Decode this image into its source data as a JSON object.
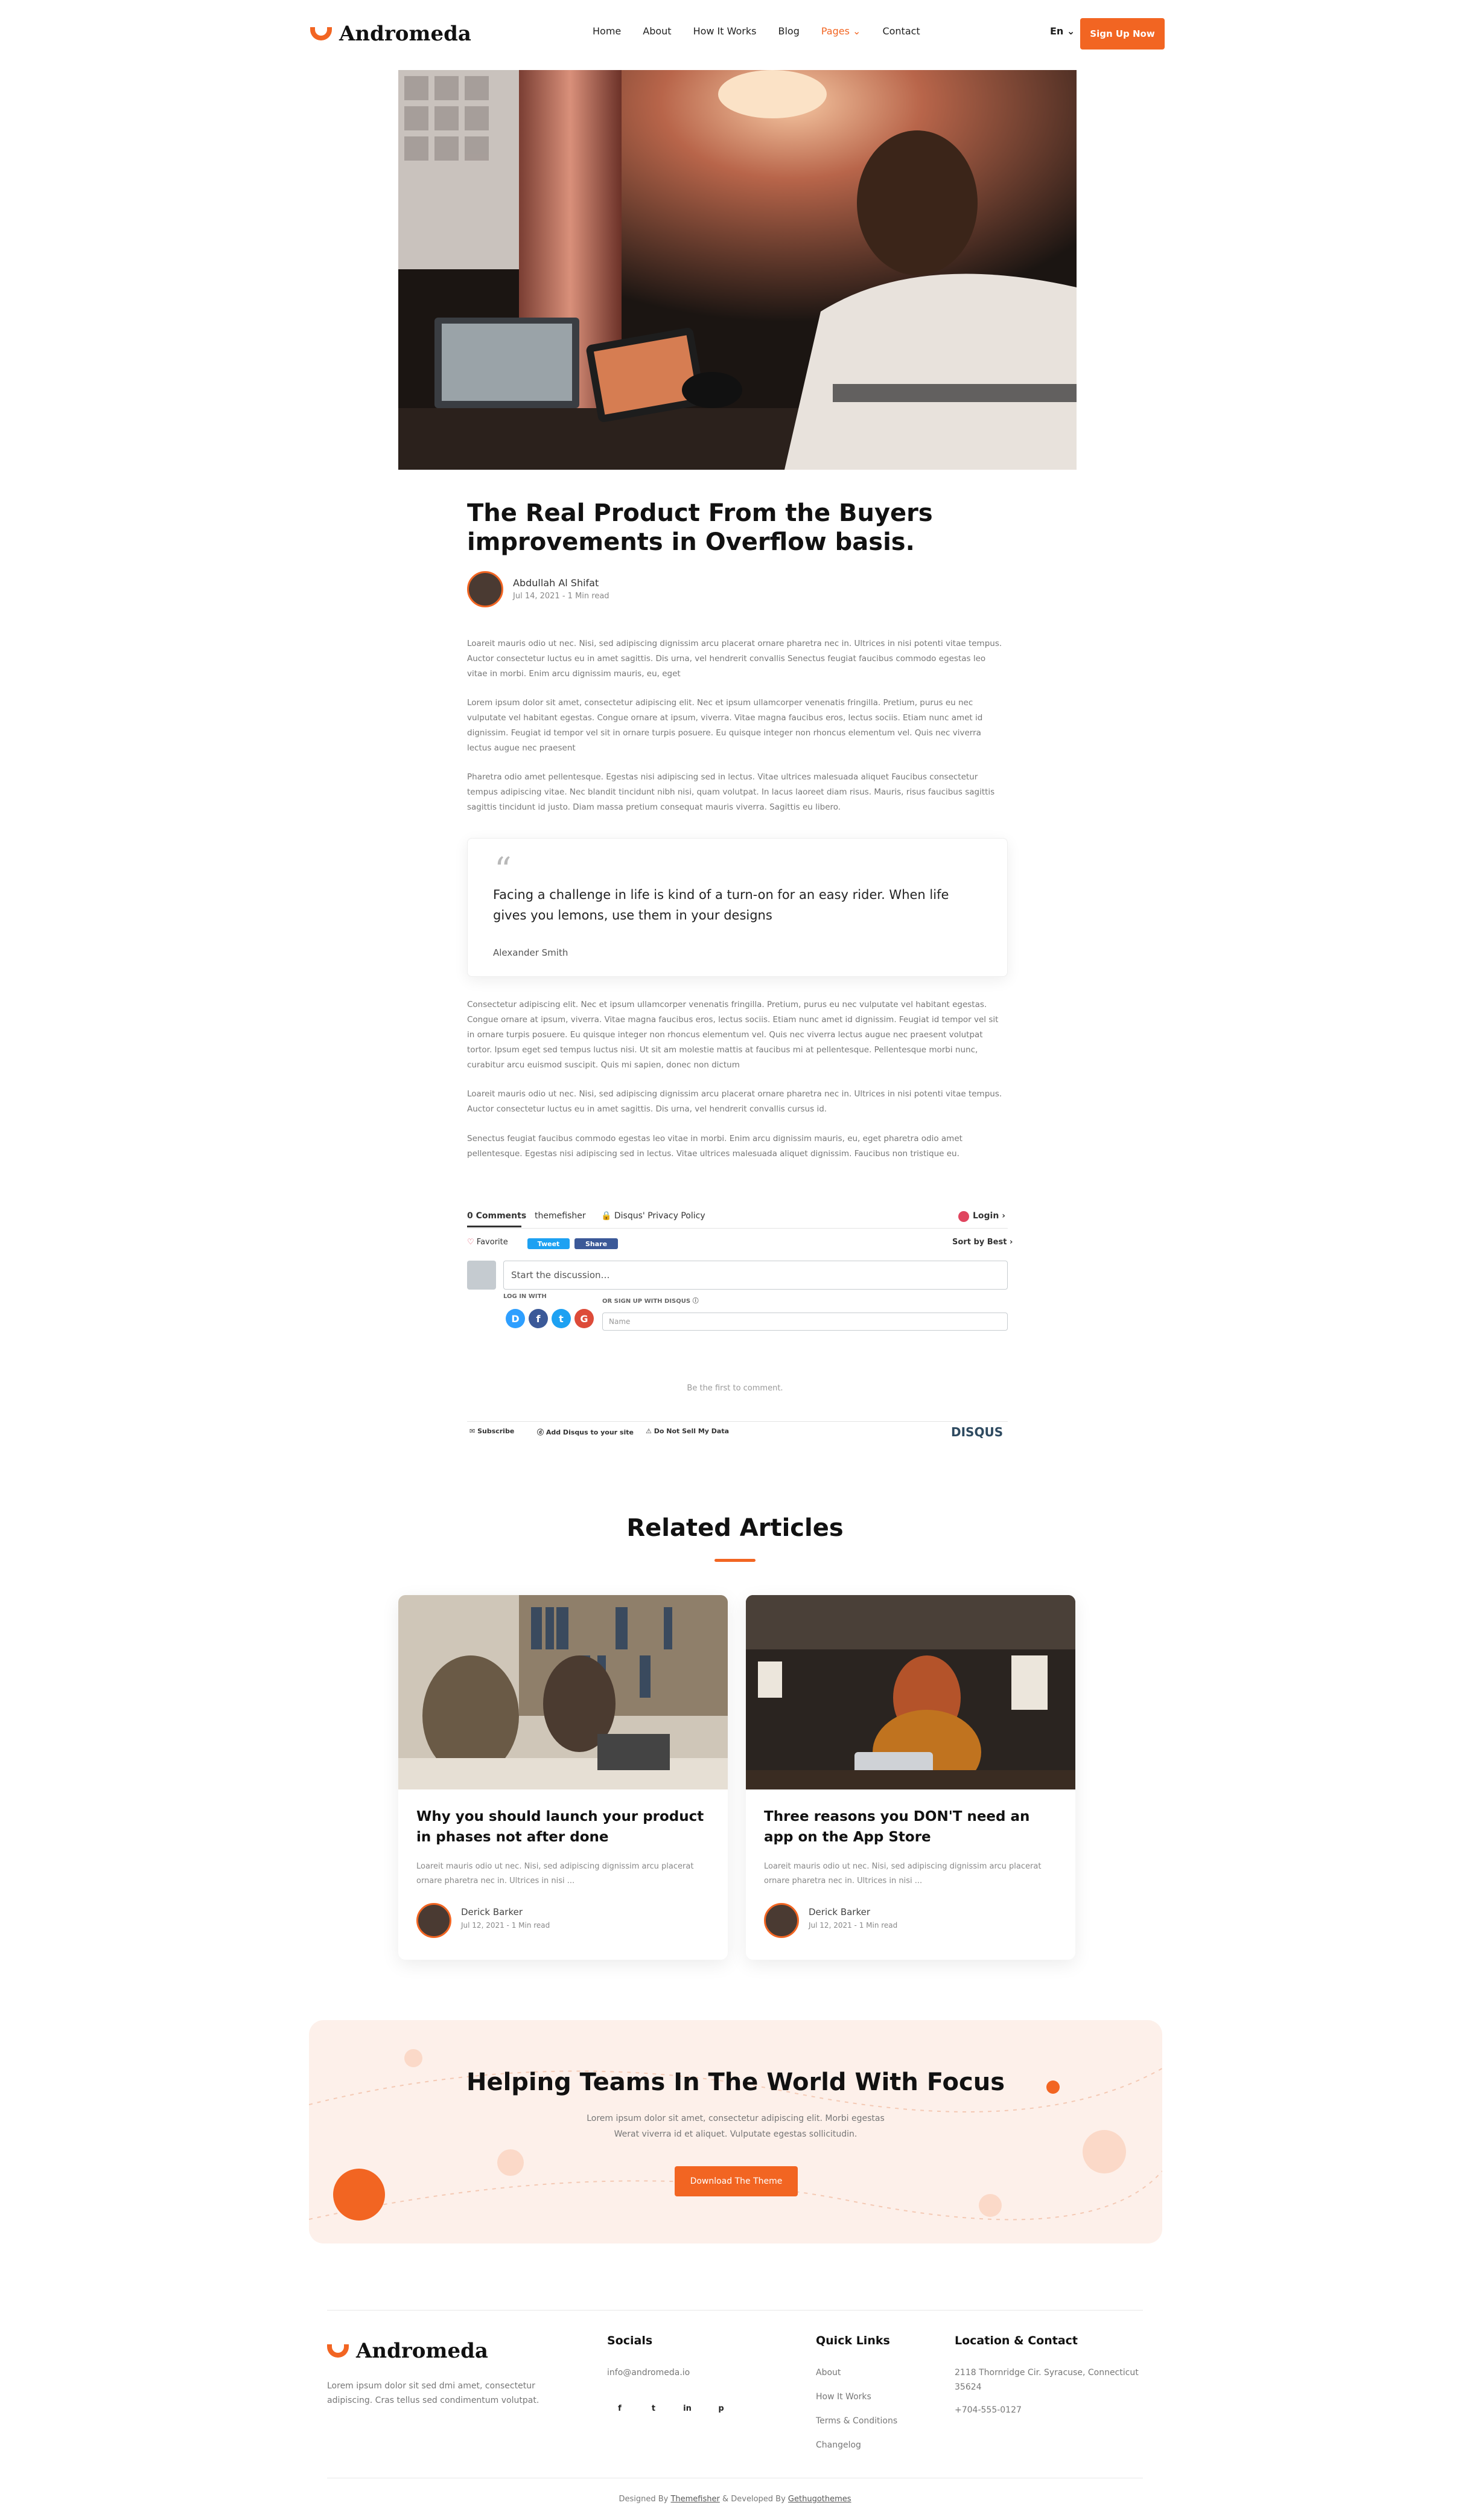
{
  "header": {
    "logo": "Andromeda",
    "nav": [
      "Home",
      "About",
      "How It Works",
      "Blog",
      "Pages",
      "Contact"
    ],
    "active_nav": "Pages",
    "language": "En",
    "signup_label": "Sign Up Now"
  },
  "article": {
    "title_line1": "The Real Product From the Buyers",
    "title_line2": "improvements in Overflow basis.",
    "author": "Abdullah Al Shifat",
    "meta": "Jul 14, 2021 - 1 Min read",
    "paragraphs": [
      "Loareit mauris odio ut nec. Nisi, sed adipiscing dignissim arcu placerat ornare pharetra nec in. Ultrices in nisi potenti vitae tempus. Auctor consectetur luctus eu in amet sagittis. Dis urna, vel hendrerit convallis Senectus feugiat faucibus commodo egestas leo vitae in morbi. Enim arcu dignissim mauris, eu, eget",
      "Lorem ipsum dolor sit amet, consectetur adipiscing elit. Nec et ipsum ullamcorper venenatis fringilla. Pretium, purus eu nec vulputate vel habitant egestas. Congue ornare at ipsum, viverra. Vitae magna faucibus eros, lectus sociis. Etiam nunc amet id dignissim. Feugiat id tempor vel sit in ornare turpis posuere. Eu quisque integer non rhoncus elementum vel. Quis nec viverra lectus augue nec praesent",
      "Pharetra odio amet pellentesque. Egestas nisi adipiscing sed in lectus. Vitae ultrices malesuada aliquet Faucibus consectetur tempus adipiscing vitae. Nec blandit tincidunt nibh nisi, quam volutpat. In lacus laoreet diam risus. Mauris, risus faucibus sagittis sagittis tincidunt id justo. Diam massa pretium consequat mauris viverra. Sagittis eu libero.",
      "Consectetur adipiscing elit. Nec et ipsum ullamcorper venenatis fringilla. Pretium, purus eu nec vulputate vel habitant egestas. Congue ornare at ipsum, viverra. Vitae magna faucibus eros, lectus sociis. Etiam nunc amet id dignissim. Feugiat id tempor vel sit in ornare turpis posuere. Eu quisque integer non rhoncus elementum vel. Quis nec viverra lectus augue nec praesent volutpat tortor. Ipsum eget sed tempus luctus nisi. Ut sit am molestie mattis at faucibus mi at pellentesque. Pellentesque morbi nunc, curabitur arcu euismod suscipit. Quis mi sapien, donec non dictum",
      "Loareit mauris odio ut nec. Nisi, sed adipiscing dignissim arcu placerat ornare pharetra nec in. Ultrices in nisi potenti vitae tempus. Auctor consectetur luctus eu in amet sagittis. Dis urna, vel hendrerit convallis cursus id.",
      "Senectus feugiat faucibus commodo egestas leo vitae in morbi. Enim arcu dignissim mauris, eu, eget pharetra odio amet pellentesque. Egestas nisi adipiscing sed in lectus. Vitae ultrices malesuada aliquet dignissim. Faucibus non tristique eu."
    ],
    "quote": "Facing a challenge in life is kind of a turn-on for an easy rider. When life gives you lemons, use them in your designs",
    "quote_author": "Alexander Smith"
  },
  "disqus": {
    "comments_tab": "0 Comments",
    "site": "themefisher",
    "privacy": "Disqus' Privacy Policy",
    "login": "Login",
    "favorite": "Favorite",
    "tweet": "Tweet",
    "share": "Share",
    "sort": "Sort by Best",
    "placeholder": "Start the discussion…",
    "log_in_with": "LOG IN WITH",
    "or_signup": "OR SIGN UP WITH DISQUS",
    "name_placeholder": "Name",
    "empty": "Be the first to comment.",
    "subscribe": "Subscribe",
    "add_disqus": "Add Disqus to your site",
    "do_not_sell": "Do Not Sell My Data",
    "brand": "DISQUS"
  },
  "related": {
    "title": "Related Articles",
    "cards": [
      {
        "title": "Why you should launch your product in phases not after done",
        "text": "Loareit mauris odio ut nec. Nisi, sed adipiscing dignissim arcu placerat ornare pharetra nec in. Ultrices in nisi ...",
        "author": "Derick Barker",
        "meta": "Jul 12, 2021 - 1 Min read"
      },
      {
        "title": "Three reasons you DON'T need an app on the App Store",
        "text": "Loareit mauris odio ut nec. Nisi, sed adipiscing dignissim arcu placerat ornare pharetra nec in. Ultrices in nisi ...",
        "author": "Derick Barker",
        "meta": "Jul 12, 2021 - 1 Min read"
      }
    ]
  },
  "cta": {
    "title": "Helping Teams In The World With Focus",
    "text": "Lorem ipsum dolor sit amet, consectetur adipiscing elit. Morbi egestas Werat viverra id et aliquet. Vulputate egestas sollicitudin.",
    "button": "Download The Theme"
  },
  "footer": {
    "logo": "Andromeda",
    "about": "Lorem ipsum dolor sit sed dmi amet, consectetur adipiscing. Cras tellus sed condimentum volutpat.",
    "socials_title": "Socials",
    "email": "info@andromeda.io",
    "social_icons": [
      "f",
      "t",
      "in",
      "p"
    ],
    "quick_links_title": "Quick Links",
    "links": [
      "About",
      "How It Works",
      "Terms & Conditions",
      "Changelog"
    ],
    "location_title": "Location & Contact",
    "address": "2118 Thornridge Cir. Syracuse, Connecticut 35624",
    "phone": "+704-555-0127",
    "credit_prefix": "Designed By",
    "credit_a": "Themefisher",
    "credit_mid": "& Developed By",
    "credit_b": "Gethugothemes"
  },
  "colors": {
    "accent": "#f26522",
    "cta_bg": "#fdf0ea"
  }
}
